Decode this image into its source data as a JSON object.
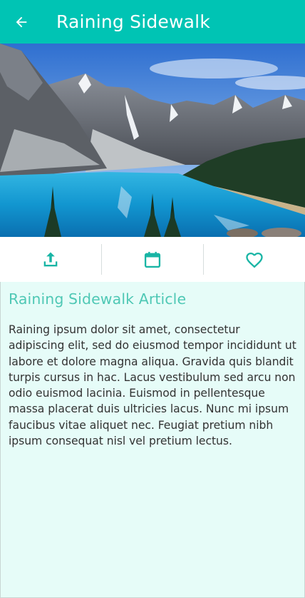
{
  "header": {
    "title": "Raining Sidewalk",
    "back_icon": "arrow-left-icon"
  },
  "hero": {
    "image": "mountain-lake-photo"
  },
  "actions": {
    "items": [
      {
        "icon": "share-upload-icon"
      },
      {
        "icon": "calendar-icon"
      },
      {
        "icon": "heart-icon"
      }
    ],
    "accent_color": "#19b5a5"
  },
  "article": {
    "title": "Raining Sidewalk Article",
    "body": "Raining ipsum dolor sit amet, consectetur adipiscing elit, sed do eiusmod tempor incididunt ut labore et dolore magna aliqua. Gravida quis blandit turpis cursus in hac. Lacus vestibulum sed arcu non odio euismod lacinia. Euismod in pellentesque massa placerat duis ultricies lacus. Nunc mi ipsum faucibus vitae aliquet nec. Feugiat pretium nibh ipsum consequat nisl vel pretium lectus."
  },
  "colors": {
    "appbar": "#00c4b4",
    "title_accent": "#4fc8b5",
    "content_bg": "#e6fcf8"
  }
}
